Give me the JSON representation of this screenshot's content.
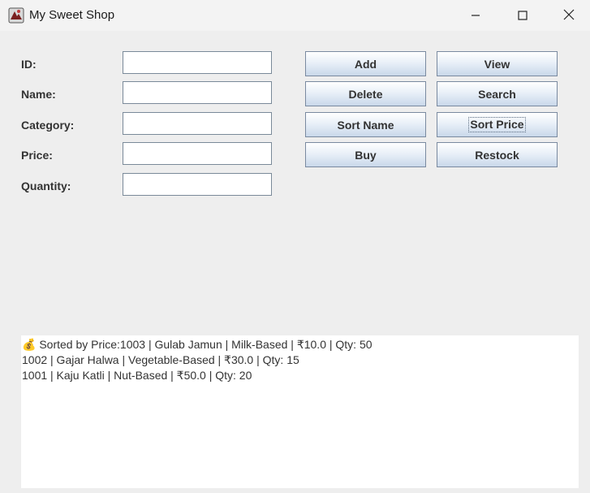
{
  "window": {
    "title": "My Sweet Shop",
    "icon": "candy-shop-app-icon",
    "controls": [
      "minimize-icon",
      "maximize-icon",
      "close-icon"
    ]
  },
  "form": {
    "id_label": "ID:",
    "name_label": "Name:",
    "category_label": "Category:",
    "price_label": "Price:",
    "quantity_label": "Quantity:",
    "id_value": "",
    "name_value": "",
    "category_value": "",
    "price_value": "",
    "quantity_value": ""
  },
  "buttons": {
    "add": "Add",
    "view": "View",
    "delete": "Delete",
    "search": "Search",
    "sort_name": "Sort Name",
    "sort_price": "Sort Price",
    "buy": "Buy",
    "restock": "Restock"
  },
  "output": {
    "lines": [
      "💰 Sorted by Price:1003 | Gulab Jamun | Milk-Based | ₹10.0 | Qty: 50",
      "1002 | Gajar Halwa | Vegetable-Based | ₹30.0 | Qty: 15",
      "1001 | Kaju Katli | Nut-Based | ₹50.0 | Qty: 20"
    ]
  }
}
